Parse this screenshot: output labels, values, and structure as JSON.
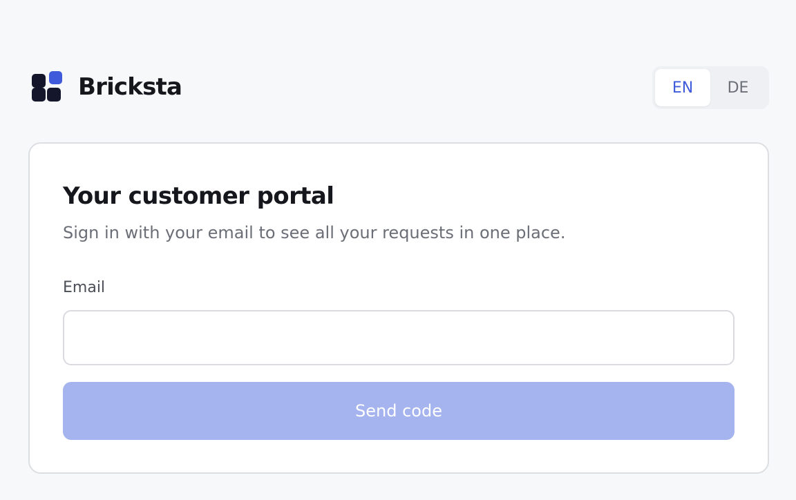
{
  "brand": {
    "name": "Bricksta",
    "logo_icon": "brick-grid-logo"
  },
  "language": {
    "options": [
      "EN",
      "DE"
    ],
    "selected": "EN"
  },
  "card": {
    "title": "Your customer portal",
    "subtitle": "Sign in with your email to see all your requests in one place.",
    "email_label": "Email",
    "email_value": "",
    "email_placeholder": "",
    "submit_label": "Send code",
    "submit_disabled": true
  },
  "colors": {
    "accent": "#3f5bdb",
    "accent_disabled": "#a5b3ee",
    "background": "#f7f8fa",
    "logo_dark": "#14172b"
  }
}
